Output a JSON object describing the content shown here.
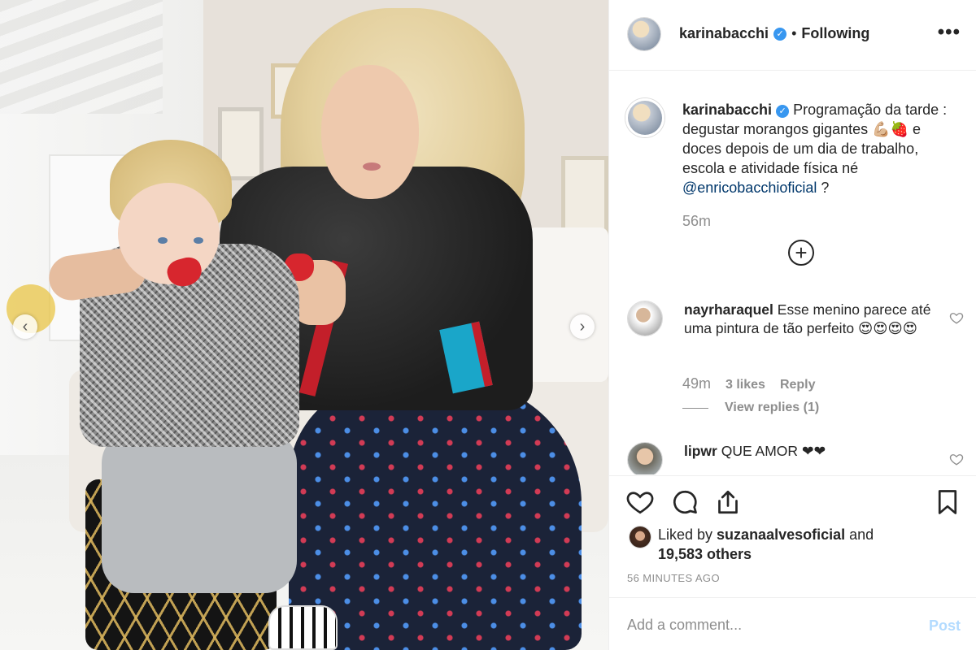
{
  "post": {
    "image_alt": "",
    "carousel": {
      "prev_glyph": "‹",
      "next_glyph": "›"
    }
  },
  "header": {
    "username": "karinabacchi",
    "verified_glyph": "✓",
    "separator": "•",
    "follow_status": "Following",
    "more_glyph": "•••"
  },
  "caption": {
    "username": "karinabacchi",
    "text_before": " Programação da tarde : degustar morangos gigantes 💪🏼🍓 e doces depois de um dia de trabalho, escola e atividade física né ",
    "mention": "@enricobacchioficial",
    "text_after": " ?",
    "time": "56m",
    "load_more_glyph": "+"
  },
  "comments": [
    {
      "username": "nayrharaquel",
      "text": " Esse menino parece até uma pintura de tão perfeito 😍😍😍😍",
      "time": "49m",
      "likes": "3 likes",
      "reply_label": "Reply",
      "view_replies": "View replies (1)"
    },
    {
      "username": "lipwr",
      "text": " QUE AMOR ❤❤"
    }
  ],
  "actions": {
    "like_icon": "heart-icon",
    "comment_icon": "comment-icon",
    "share_icon": "share-icon",
    "save_icon": "bookmark-icon"
  },
  "likes": {
    "prefix": "Liked by ",
    "liked_by": "suzanaalvesoficial",
    "middle": " and",
    "others": "19,583 others"
  },
  "timestamp": "56 MINUTES AGO",
  "add_comment": {
    "placeholder": "Add a comment...",
    "post_label": "Post"
  },
  "colors": {
    "verified": "#3897f0",
    "mention": "#00376b",
    "muted": "#8e8e8e",
    "post_disabled": "#b3dbff"
  }
}
